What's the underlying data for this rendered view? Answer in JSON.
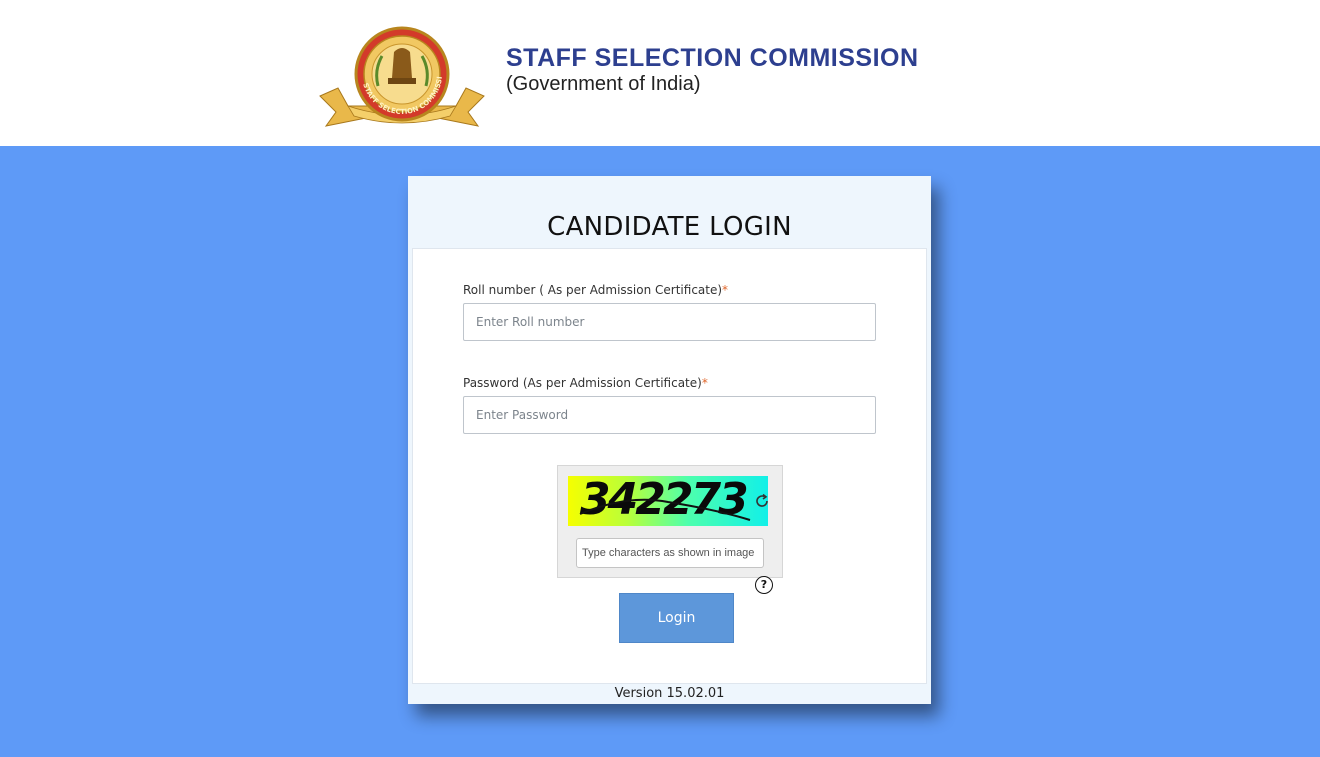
{
  "header": {
    "org_title": "STAFF SELECTION COMMISSION",
    "org_subtitle": "(Government of India)",
    "emblem_icon": "ssc-emblem-icon",
    "emblem_ring_text": "STAFF SELECTION COMMISSION"
  },
  "login": {
    "title": "CANDIDATE LOGIN",
    "roll_label": "Roll number ( As per Admission Certificate)",
    "roll_placeholder": "Enter Roll number",
    "roll_value": "",
    "password_label": "Password (As per Admission Certificate)",
    "password_placeholder": "Enter Password",
    "password_value": "",
    "required_mark": "*",
    "captcha_text": "342273",
    "captcha_placeholder": "Type characters as shown in image",
    "captcha_value": "",
    "help_mark": "?",
    "login_label": "Login",
    "version": "Version 15.02.01"
  },
  "colors": {
    "page_bg": "#5e9af7",
    "header_bg": "#ffffff",
    "title_color": "#2d3f8f",
    "button_bg": "#5d97da",
    "required_color": "#e0662a"
  }
}
